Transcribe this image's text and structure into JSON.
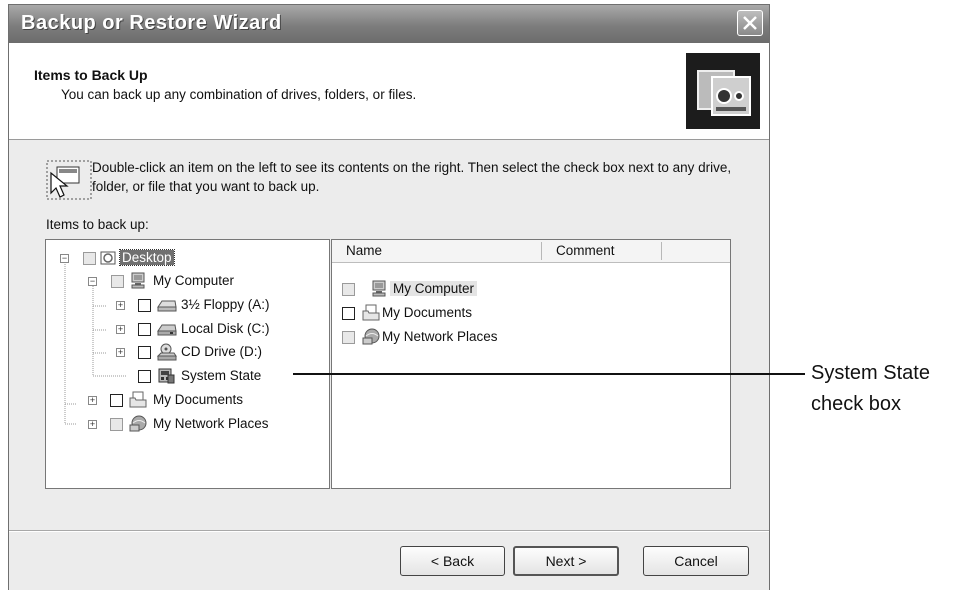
{
  "window": {
    "title": "Backup or Restore Wizard"
  },
  "header": {
    "heading": "Items to Back Up",
    "subheading": "You can back up any combination of drives, folders, or files."
  },
  "instructions": "Double-click an item on the left to see its contents on the right. Then select the check box next to any drive, folder, or file that you want to back up.",
  "tree_label": "Items to back up:",
  "tree": [
    {
      "label": "Desktop",
      "icon": "desktop-icon",
      "checkbox": "grey",
      "expander": "minus",
      "selected": true
    },
    {
      "label": "My Computer",
      "icon": "computer-icon",
      "checkbox": "grey",
      "expander": "minus"
    },
    {
      "label": "3½ Floppy (A:)",
      "icon": "floppy-drive-icon",
      "checkbox": "unchecked",
      "expander": "plus"
    },
    {
      "label": "Local Disk (C:)",
      "icon": "hard-disk-icon",
      "checkbox": "unchecked",
      "expander": "plus"
    },
    {
      "label": "CD Drive (D:)",
      "icon": "cd-drive-icon",
      "checkbox": "unchecked",
      "expander": "plus"
    },
    {
      "label": "System State",
      "icon": "system-state-icon",
      "checkbox": "unchecked",
      "expander": "none"
    },
    {
      "label": "My Documents",
      "icon": "documents-folder-icon",
      "checkbox": "unchecked",
      "expander": "plus"
    },
    {
      "label": "My Network Places",
      "icon": "network-places-icon",
      "checkbox": "grey",
      "expander": "plus"
    }
  ],
  "list": {
    "columns": [
      "Name",
      "Comment"
    ],
    "items": [
      {
        "label": "My Computer",
        "icon": "computer-icon",
        "checkbox": "grey",
        "highlighted": true
      },
      {
        "label": "My Documents",
        "icon": "documents-folder-icon",
        "checkbox": "unchecked"
      },
      {
        "label": "My Network Places",
        "icon": "network-places-icon",
        "checkbox": "grey"
      }
    ]
  },
  "buttons": {
    "back": "< Back",
    "next": "Next >",
    "cancel": "Cancel"
  },
  "callout": {
    "line1": "System State",
    "line2": "check box"
  }
}
